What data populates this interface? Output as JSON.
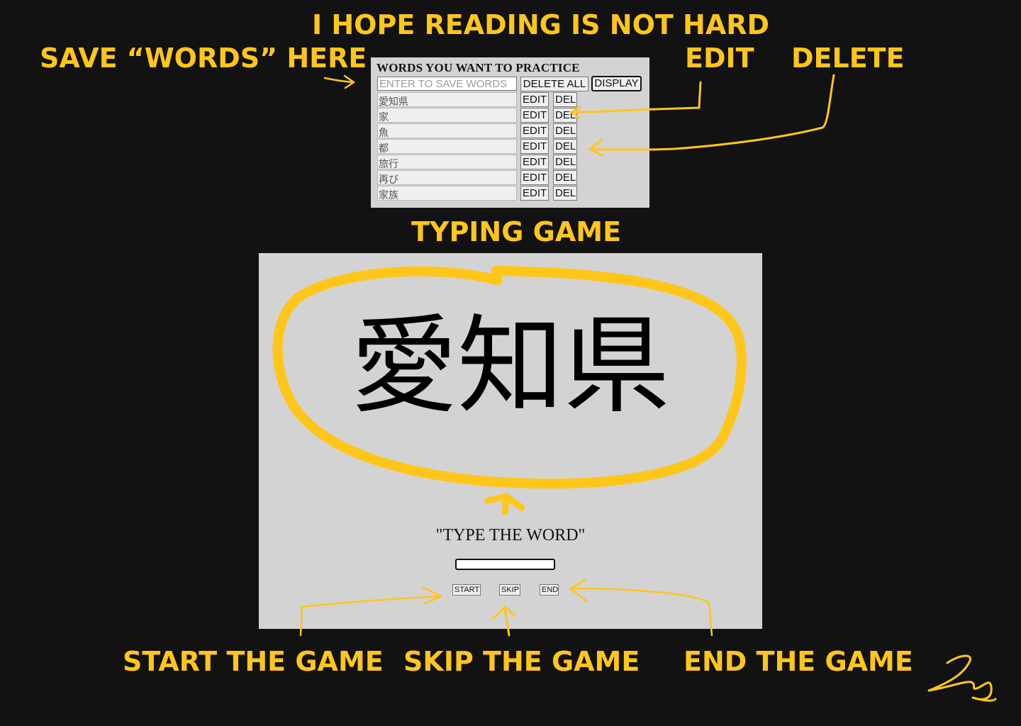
{
  "annotations": {
    "title": "I HOPE READING IS NOT HARD",
    "save_words": "SAVE “WORDS” HERE",
    "edit": "EDIT",
    "delete": "DELETE",
    "typing_game": "TYPING GAME",
    "start": "START THE GAME",
    "skip": "SKIP THE GAME",
    "end": "END THE GAME",
    "color": "#FFC61A"
  },
  "word_panel": {
    "heading": "WORDS YOU WANT TO PRACTICE",
    "input_placeholder": "ENTER TO SAVE WORDS",
    "delete_all_label": "DELETE ALL",
    "display_label": "DISPLAY",
    "edit_label": "EDIT",
    "del_label": "DEL",
    "words": [
      "愛知県",
      "家",
      "魚",
      "都",
      "旅行",
      "再び",
      "家族"
    ]
  },
  "game": {
    "current_word": "愛知県",
    "prompt": "\"TYPE THE WORD\"",
    "input_value": "",
    "start_label": "START",
    "skip_label": "SKIP",
    "end_label": "END"
  }
}
